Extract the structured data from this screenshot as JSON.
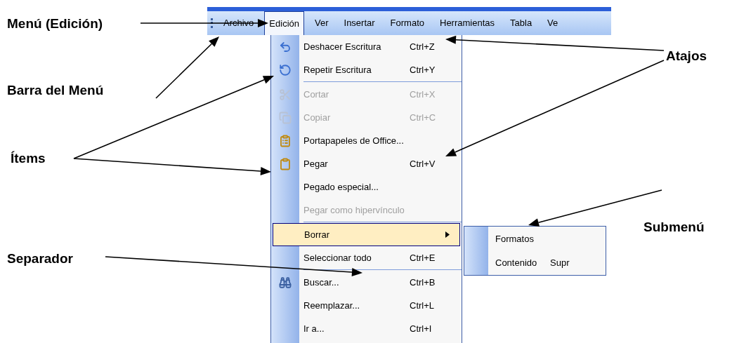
{
  "menu_bar": {
    "items": [
      {
        "label": "Archivo",
        "selected": false
      },
      {
        "label": "Edición",
        "selected": true
      },
      {
        "label": "Ver",
        "selected": false
      },
      {
        "label": "Insertar",
        "selected": false
      },
      {
        "label": "Formato",
        "selected": false
      },
      {
        "label": "Herramientas",
        "selected": false
      },
      {
        "label": "Tabla",
        "selected": false
      },
      {
        "label": "Ve",
        "selected": false
      }
    ]
  },
  "edit_menu": {
    "groups": [
      [
        {
          "label": "Deshacer Escritura",
          "shortcut": "Ctrl+Z",
          "disabled": false,
          "selected": false,
          "kind": "item"
        },
        {
          "label": "Repetir Escritura",
          "shortcut": "Ctrl+Y",
          "disabled": false,
          "selected": false,
          "kind": "item"
        }
      ],
      [
        {
          "label": "Cortar",
          "shortcut": "Ctrl+X",
          "disabled": true,
          "selected": false,
          "kind": "item"
        },
        {
          "label": "Copiar",
          "shortcut": "Ctrl+C",
          "disabled": true,
          "selected": false,
          "kind": "item"
        },
        {
          "label": "Portapapeles de Office...",
          "disabled": false,
          "selected": false,
          "kind": "item"
        },
        {
          "label": "Pegar",
          "shortcut": "Ctrl+V",
          "disabled": false,
          "selected": false,
          "kind": "item"
        },
        {
          "label": "Pegado especial...",
          "disabled": false,
          "selected": false,
          "kind": "item"
        },
        {
          "label": "Pegar como hipervínculo",
          "disabled": true,
          "selected": false,
          "kind": "item"
        }
      ],
      [
        {
          "label": "Borrar",
          "disabled": false,
          "selected": true,
          "kind": "submenu"
        },
        {
          "label": "Seleccionar todo",
          "shortcut": "Ctrl+E",
          "disabled": false,
          "selected": false,
          "kind": "item"
        }
      ],
      [
        {
          "label": "Buscar...",
          "shortcut": "Ctrl+B",
          "disabled": false,
          "selected": false,
          "kind": "item"
        },
        {
          "label": "Reemplazar...",
          "shortcut": "Ctrl+L",
          "disabled": false,
          "selected": false,
          "kind": "item"
        },
        {
          "label": "Ir a...",
          "shortcut": "Ctrl+I",
          "disabled": false,
          "selected": false,
          "kind": "item"
        }
      ]
    ]
  },
  "submenu": {
    "items": [
      {
        "label": "Formatos"
      },
      {
        "label": "Contenido",
        "shortcut": "Supr"
      }
    ]
  },
  "annotations": [
    {
      "label": "Menú (Edición)"
    },
    {
      "label": "Barra del Menú"
    },
    {
      "label": "Ítems"
    },
    {
      "label": "Atajos"
    },
    {
      "label": "Submenú"
    },
    {
      "label": "Separador"
    }
  ]
}
